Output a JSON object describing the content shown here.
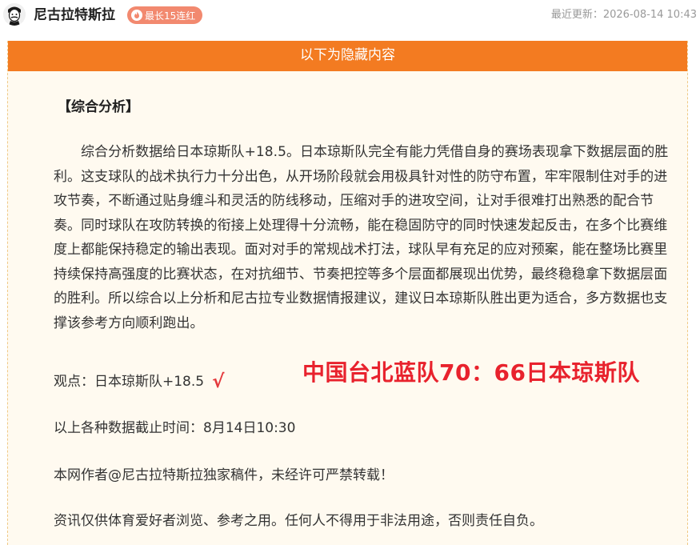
{
  "header": {
    "author_name": "尼古拉特斯拉",
    "streak_badge": "最长15连红",
    "updated_label": "最近更新：",
    "updated_time": "2026-08-14 10:43"
  },
  "hidden_banner": "以下为隐藏内容",
  "article": {
    "section_title": "【综合分析】",
    "analysis": "综合分析数据给日本琼斯队+18.5。日本琼斯队完全有能力凭借自身的赛场表现拿下数据层面的胜利。这支球队的战术执行力十分出色，从开场阶段就会用极具针对性的防守布置，牢牢限制住对手的进攻节奏，不断通过贴身缠斗和灵活的防线移动，压缩对手的进攻空间，让对手很难打出熟悉的配合节奏。同时球队在攻防转换的衔接上处理得十分流畅，能在稳固防守的同时快速发起反击，在多个比赛维度上都能保持稳定的输出表现。面对对手的常规战术打法，球队早有充足的应对预案，能在整场比赛里持续保持高强度的比赛状态，在对抗细节、节奏把控等多个层面都展现出优势，最终稳稳拿下数据层面的胜利。所以综合以上分析和尼古拉专业数据情报建议，建议日本琼斯队胜出更为适合，多方数据也支撑该参考方向顺利跑出。",
    "viewpoint": "观点：日本琼斯队+18.5",
    "check_mark": "√",
    "score_result": "中国台北蓝队70：66日本琼斯队",
    "cutoff": "以上各种数据截止时间：8月14日10:30",
    "copyright": "本网作者@尼古拉特斯拉独家稿件，未经许可严禁转载！",
    "disclaimer": "资讯仅供体育爱好者浏览、参考之用。任何人不得用于非法用途，否则责任自负。"
  },
  "colors": {
    "banner": "#f37b21",
    "badge": "#f2896f",
    "box_background": "#fffaf0",
    "result_red": "#e8222d"
  },
  "icons": [
    "tesla-avatar",
    "fire-icon"
  ]
}
